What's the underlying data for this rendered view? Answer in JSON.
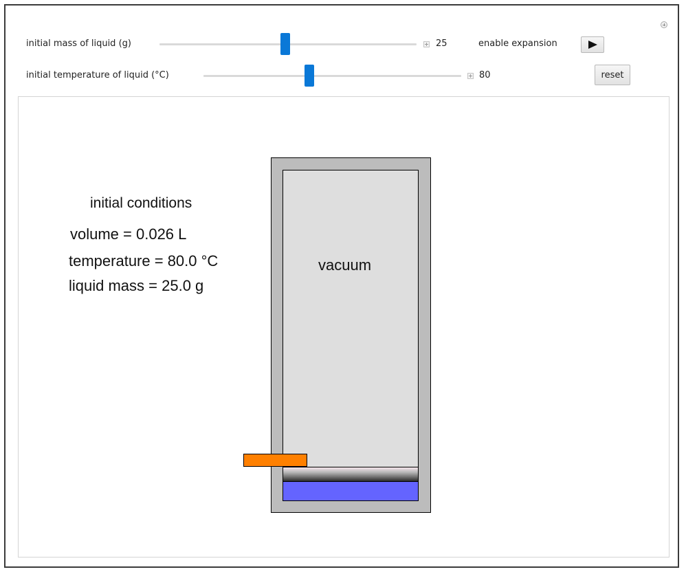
{
  "controls": {
    "mass": {
      "label": "initial mass of liquid (g)",
      "value": "25",
      "fraction": 0.49
    },
    "temperature": {
      "label": "initial temperature of liquid (°C)",
      "value": "80",
      "fraction": 0.41
    },
    "expansion": {
      "label": "enable expansion"
    },
    "reset_label": "reset"
  },
  "conditions": {
    "heading": "initial conditions",
    "volume": "volume = 0.026 L",
    "temperature": "temperature = 80.0 °C",
    "liquid_mass": "liquid mass = 25.0 g"
  },
  "cylinder": {
    "region_label": "vacuum"
  },
  "colors": {
    "slider_thumb": "#0a78d7",
    "liquid": "#6464ff",
    "latch": "#ff8000",
    "cylinder_wall": "#bcbcbc",
    "vacuum": "#dedede"
  },
  "icons": {
    "play": "play-icon",
    "options": "plus-circle-icon"
  }
}
